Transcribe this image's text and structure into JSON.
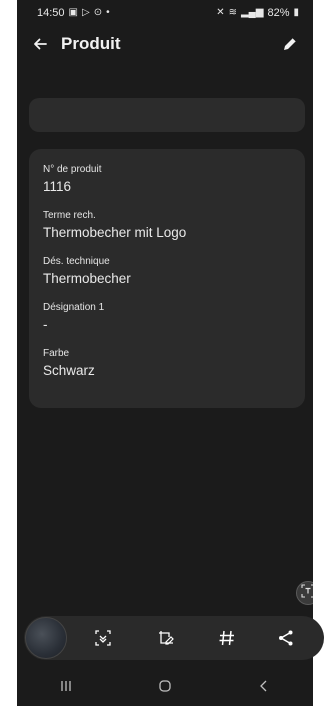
{
  "status_bar": {
    "time": "14:50",
    "battery": "82%"
  },
  "app_bar": {
    "title": "Produit",
    "back_icon": "arrow-left-icon",
    "edit_icon": "pencil-icon"
  },
  "product": {
    "fields": [
      {
        "label": "N° de produit",
        "value": "1116"
      },
      {
        "label": "Terme rech.",
        "value": "Thermobecher mit Logo"
      },
      {
        "label": "Dés. technique",
        "value": "Thermobecher"
      },
      {
        "label": "Désignation 1",
        "value": "-"
      },
      {
        "label": "Farbe",
        "value": "Schwarz"
      }
    ]
  },
  "colors": {
    "background": "#1b1b1b",
    "card": "#2b2b2b",
    "text": "#e9e9e9"
  }
}
